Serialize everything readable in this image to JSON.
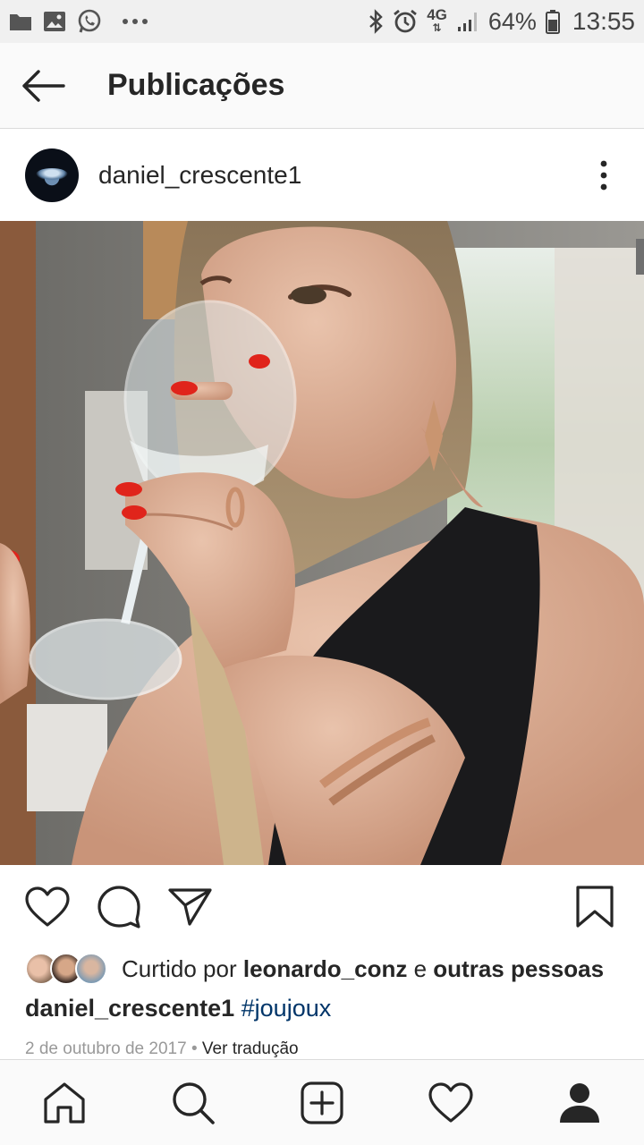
{
  "status_bar": {
    "battery_percent": "64%",
    "time": "13:55",
    "network": "4G",
    "icons": [
      "folder-icon",
      "gallery-icon",
      "whatsapp-icon",
      "more-notifications-icon",
      "bluetooth-icon",
      "alarm-icon",
      "signal-icon",
      "battery-icon"
    ]
  },
  "header": {
    "title": "Publicações",
    "back_icon": "arrow-left-icon"
  },
  "post": {
    "username": "daniel_crescente1",
    "more_icon": "vertical-dots-icon",
    "actions": [
      "heart-icon",
      "comment-icon",
      "share-icon",
      "bookmark-icon"
    ],
    "likes": {
      "prefix": "Curtido por",
      "user": "leonardo_conz",
      "conjunction": "e",
      "others": "outras pessoas"
    },
    "caption": {
      "user": "daniel_crescente1",
      "hashtag": "#joujoux"
    },
    "date": "2 de outubro de 2017",
    "separator": "•",
    "translate": "Ver tradução"
  },
  "bottom_nav": [
    "home-icon",
    "search-icon",
    "add-post-icon",
    "activity-heart-icon",
    "profile-icon"
  ],
  "colors": {
    "text": "#262626",
    "hashtag": "#003569",
    "muted": "#999999",
    "nail_polish": "#e0241b"
  }
}
